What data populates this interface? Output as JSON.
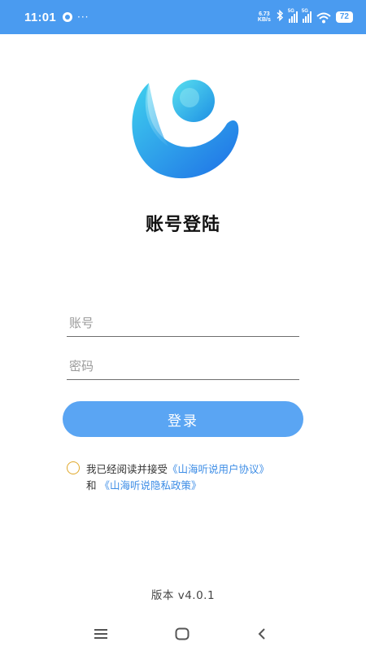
{
  "status_bar": {
    "time": "11:01",
    "more": "···",
    "net_speed_value": "6.73",
    "net_speed_unit": "KB/s",
    "signal1_tag": "5G",
    "signal2_tag": "5G",
    "battery": "72",
    "icons": [
      "camera-dot-icon",
      "bluetooth-icon",
      "signal-icon",
      "wifi-icon",
      "battery-icon"
    ]
  },
  "login": {
    "title": "账号登陆",
    "account_placeholder": "账号",
    "account_value": "",
    "password_placeholder": "密码",
    "password_value": "",
    "submit_label": "登录"
  },
  "agreement": {
    "prefix": "我已经阅读并接受",
    "user_agreement_link": "《山海听说用户协议》",
    "conjunction": "和",
    "privacy_policy_link": "《山海听说隐私政策》",
    "checked": false
  },
  "footer": {
    "version": "版本 v4.0.1"
  },
  "nav_bar": {
    "icons": [
      "menu-icon",
      "home-icon",
      "back-icon"
    ]
  },
  "colors": {
    "status_bar": "#4a9bf0",
    "button": "#5aa5f3",
    "link": "#3d8de6",
    "radio_border": "#e0a82a"
  }
}
